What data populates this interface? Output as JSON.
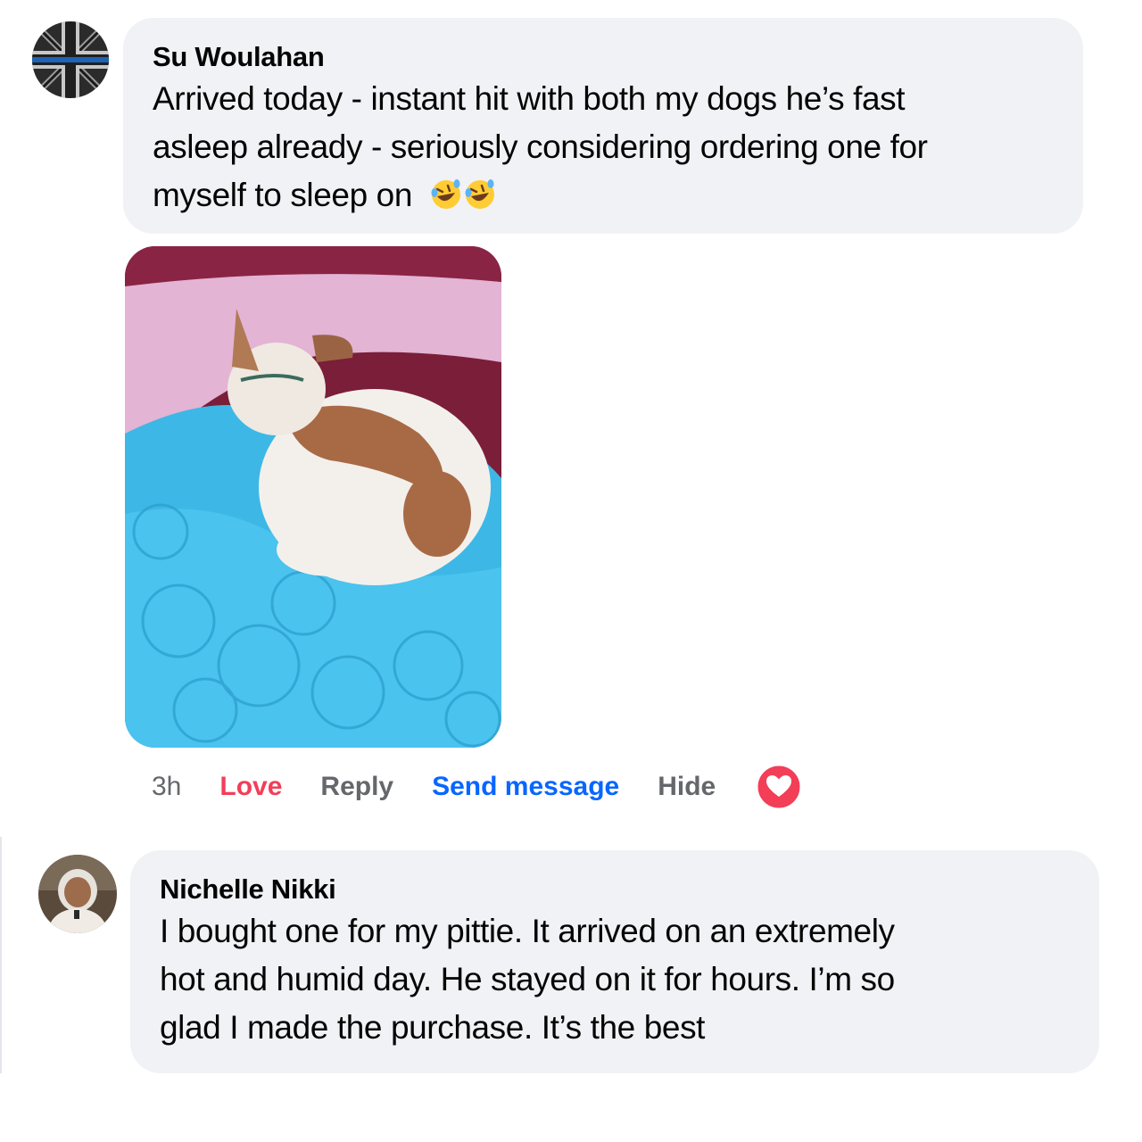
{
  "comments": [
    {
      "author": "Su Woulahan",
      "lines": [
        "Arrived today - instant hit with both my dogs he’s fast",
        "asleep already - seriously considering ordering one for",
        "myself to sleep on"
      ],
      "emojis": [
        "rolling-on-floor-laughing-emoji",
        "rolling-on-floor-laughing-emoji"
      ],
      "has_photo": true
    },
    {
      "author": "Nichelle Nikki",
      "lines": [
        "I bought one for my pittie. It arrived on an extremely",
        "hot and humid day. He stayed on it for hours. I’m so",
        "glad I made the purchase. It’s the best"
      ]
    }
  ],
  "actions": {
    "time": "3h",
    "love": "Love",
    "reply": "Reply",
    "send_message": "Send message",
    "hide": "Hide",
    "reaction_icon": "love-heart-icon"
  },
  "colors": {
    "bubble": "#f0f2f5",
    "love": "#f33e58",
    "link": "#0866ff",
    "muted": "#65676b"
  }
}
